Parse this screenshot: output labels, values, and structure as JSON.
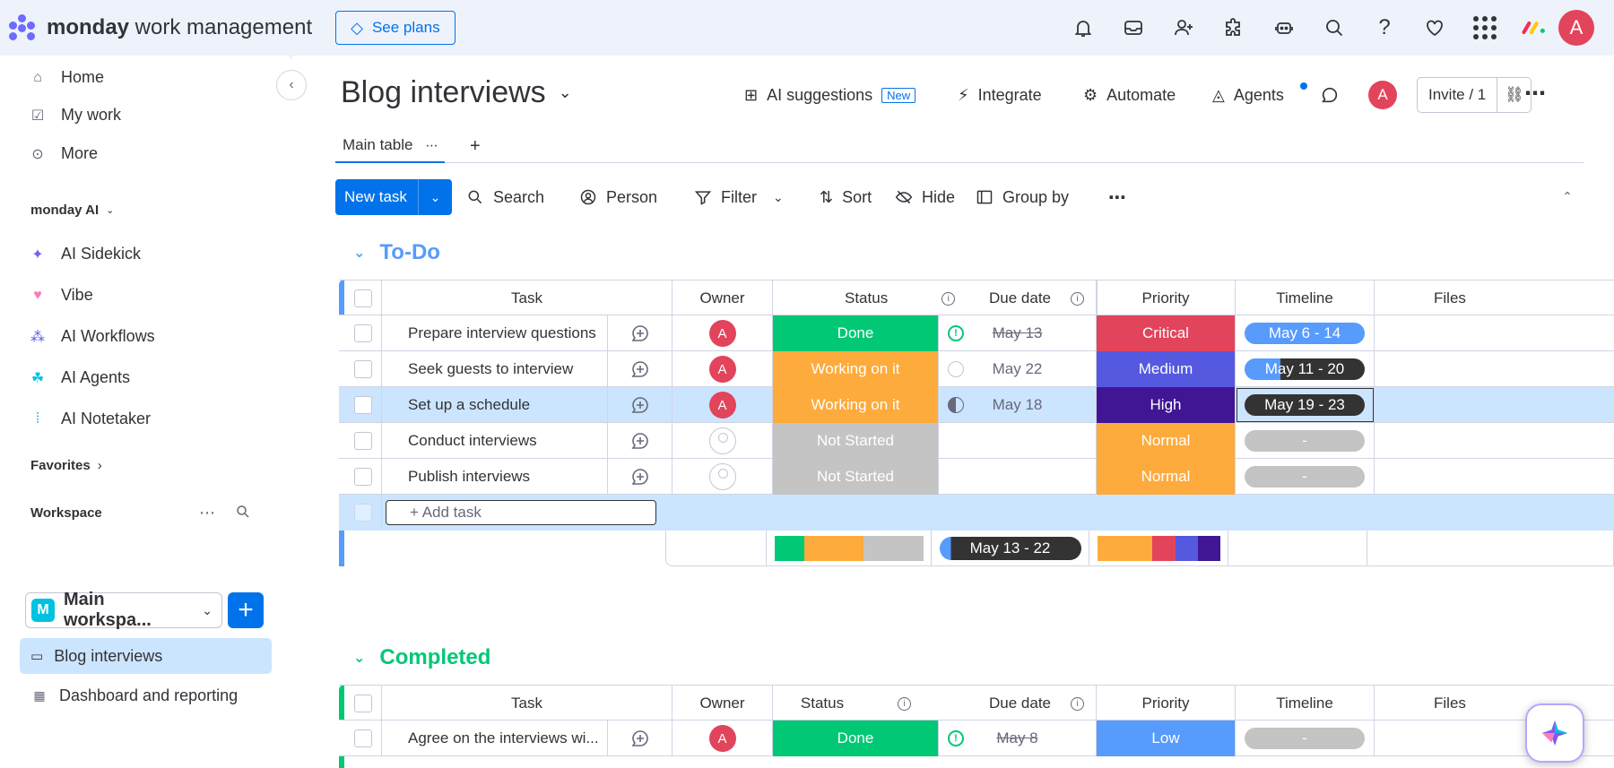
{
  "topbar": {
    "brand_bold": "monday",
    "brand_rest": " work management",
    "see_plans": "See plans",
    "avatar_letter": "A"
  },
  "sidebar": {
    "items": [
      {
        "label": "Home",
        "icon": "home-icon"
      },
      {
        "label": "My work",
        "icon": "calendar-check-icon"
      },
      {
        "label": "More",
        "icon": "more-circle-icon"
      }
    ],
    "ai_section": "monday AI",
    "ai_items": [
      {
        "label": "AI Sidekick",
        "icon": "sidekick-icon"
      },
      {
        "label": "Vibe",
        "icon": "vibe-heart-icon"
      },
      {
        "label": "AI Workflows",
        "icon": "workflows-icon"
      },
      {
        "label": "AI Agents",
        "icon": "agents-icon"
      },
      {
        "label": "AI Notetaker",
        "icon": "notetaker-icon"
      }
    ],
    "favorites": "Favorites",
    "workspace": "Workspace",
    "workspace_name": "Main workspa...",
    "workspace_letter": "M",
    "boards": [
      {
        "label": "Blog interviews"
      },
      {
        "label": "Dashboard and reporting"
      }
    ]
  },
  "board": {
    "title": "Blog interviews",
    "actions": {
      "ai_suggestions": "AI suggestions",
      "new_badge": "New",
      "integrate": "Integrate",
      "automate": "Automate",
      "agents": "Agents",
      "avatar": "A",
      "invite": "Invite / 1"
    },
    "tabs": {
      "main": "Main table"
    },
    "toolbar": {
      "new_task": "New task",
      "search": "Search",
      "person": "Person",
      "filter": "Filter",
      "sort": "Sort",
      "hide": "Hide",
      "group_by": "Group by"
    }
  },
  "columns": {
    "task": "Task",
    "owner": "Owner",
    "status": "Status",
    "due": "Due date",
    "priority": "Priority",
    "timeline": "Timeline",
    "files": "Files"
  },
  "groups": [
    {
      "title": "To-Do",
      "color": "#579bfc",
      "rows": [
        {
          "task": "Prepare interview questions",
          "owner": "A",
          "status": "Done",
          "status_color": "#00c875",
          "due": "May 13",
          "priority": "Critical",
          "priority_color": "#e2445c",
          "timeline": "May 6 - 14"
        },
        {
          "task": "Seek guests to interview",
          "owner": "A",
          "status": "Working on it",
          "status_color": "#fdab3d",
          "due": "May 22",
          "priority": "Medium",
          "priority_color": "#5559df",
          "timeline": "May 11 - 20"
        },
        {
          "task": "Set up a schedule",
          "owner": "A",
          "status": "Working on it",
          "status_color": "#fdab3d",
          "due": "May 18",
          "priority": "High",
          "priority_color": "#401694",
          "timeline": "May 19 - 23"
        },
        {
          "task": "Conduct interviews",
          "owner": "",
          "status": "Not Started",
          "status_color": "#c4c4c4",
          "due": "",
          "priority": "Normal",
          "priority_color": "#fdab3d",
          "timeline": "-"
        },
        {
          "task": "Publish interviews",
          "owner": "",
          "status": "Not Started",
          "status_color": "#c4c4c4",
          "due": "",
          "priority": "Normal",
          "priority_color": "#fdab3d",
          "timeline": "-"
        }
      ],
      "add_task": "+ Add task",
      "summary_timeline": "May 13 - 22"
    },
    {
      "title": "Completed",
      "color": "#00c875",
      "rows": [
        {
          "task": "Agree on the interviews wi...",
          "owner": "A",
          "status": "Done",
          "status_color": "#00c875",
          "due": "May 8",
          "priority": "Low",
          "priority_color": "#579bfc",
          "timeline": "-"
        }
      ]
    }
  ]
}
